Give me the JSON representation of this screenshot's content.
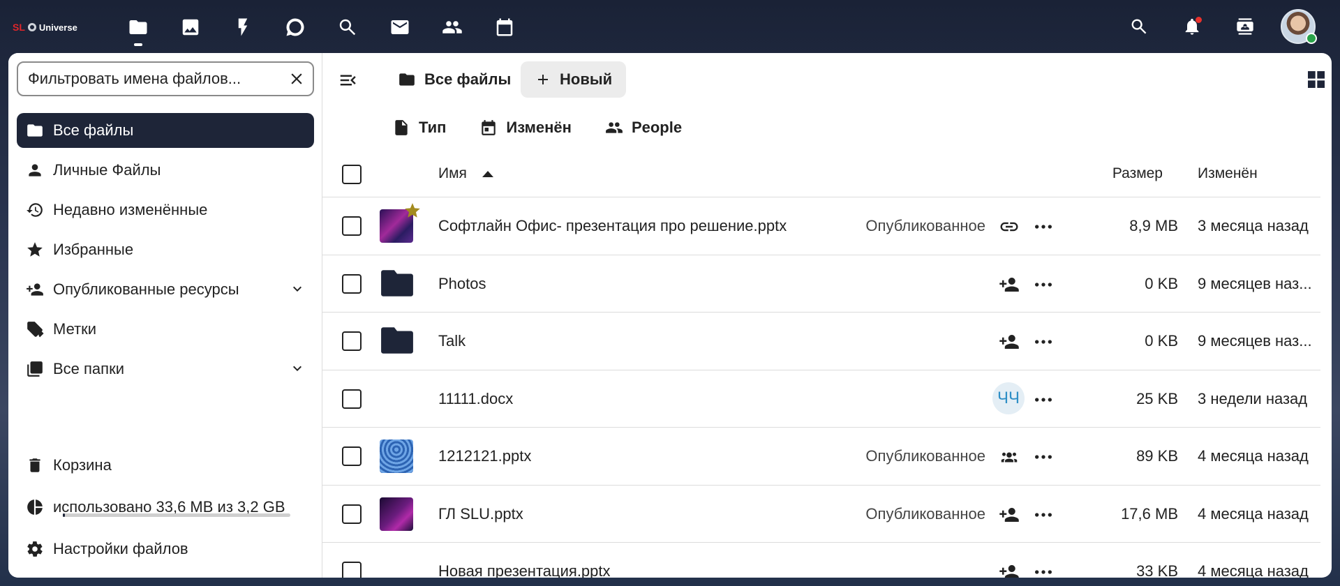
{
  "topbar": {
    "logo": {
      "sl": "SL",
      "text": "Universe"
    },
    "apps": [
      {
        "name": "files",
        "icon": "folder-icon"
      },
      {
        "name": "photos",
        "icon": "image-icon"
      },
      {
        "name": "activity",
        "icon": "bolt-icon"
      },
      {
        "name": "talk",
        "icon": "chat-icon"
      },
      {
        "name": "search-app",
        "icon": "magnify-icon"
      },
      {
        "name": "mail",
        "icon": "mail-icon"
      },
      {
        "name": "contacts",
        "icon": "contacts-icon"
      },
      {
        "name": "calendar",
        "icon": "calendar-icon"
      }
    ],
    "right_icons": [
      "search-icon",
      "bell-icon",
      "contacts-menu-icon"
    ],
    "accent_color": "#1e2538"
  },
  "sidebar": {
    "filter_placeholder": "Фильтровать имена файлов...",
    "items": [
      {
        "label": "Все файлы",
        "icon": "folder-icon",
        "active": true
      },
      {
        "label": "Личные Файлы",
        "icon": "account-icon"
      },
      {
        "label": "Недавно изменённые",
        "icon": "history-icon"
      },
      {
        "label": "Избранные",
        "icon": "star-icon"
      },
      {
        "label": "Опубликованные ресурсы",
        "icon": "share-user-icon",
        "expandable": true
      },
      {
        "label": "Метки",
        "icon": "tags-icon"
      },
      {
        "label": "Все папки",
        "icon": "folders-icon",
        "expandable": true
      }
    ],
    "bottom": {
      "trash_label": "Корзина",
      "quota_label": "использовано 33,6 MB из 3,2 GB",
      "quota_fraction": 0.01,
      "settings_label": "Настройки файлов"
    }
  },
  "main": {
    "breadcrumb": "Все файлы",
    "new_label": "Новый",
    "filters": {
      "type": "Тип",
      "modified": "Изменён",
      "people": "People"
    },
    "columns": {
      "name": "Имя",
      "size": "Размер",
      "modified": "Изменён"
    },
    "rows": [
      {
        "name": "Софтлайн Офис- презентация про решение.pptx",
        "share_label": "Опубликованное",
        "share_icon": "link-icon",
        "size": "8,9 MB",
        "modified": "3 месяца назад",
        "thumb": "ppt1",
        "favorite": true
      },
      {
        "name": "Photos",
        "share_label": "",
        "share_icon": "share-user-icon",
        "size": "0 KB",
        "modified": "9 месяцев наз...",
        "thumb": "folder"
      },
      {
        "name": "Talk",
        "share_label": "",
        "share_icon": "share-user-icon",
        "size": "0 KB",
        "modified": "9 месяцев наз...",
        "thumb": "folder"
      },
      {
        "name": "11111.docx",
        "share_label": "",
        "share_initials": "ЧЧ",
        "size": "25 KB",
        "modified": "3 недели назад",
        "thumb": "none"
      },
      {
        "name": "1212121.pptx",
        "share_label": "Опубликованное",
        "share_icon": "group-icon",
        "size": "89 KB",
        "modified": "4 месяца назад",
        "thumb": "ppt2"
      },
      {
        "name": "ГЛ SLU.pptx",
        "share_label": "Опубликованное",
        "share_icon": "share-user-icon",
        "size": "17,6 MB",
        "modified": "4 месяца назад",
        "thumb": "ppt3"
      },
      {
        "name": "Новая презентация.pptx",
        "share_label": "",
        "share_icon": "share-user-icon",
        "size": "33 KB",
        "modified": "4 месяца назад",
        "thumb": "none"
      }
    ]
  }
}
